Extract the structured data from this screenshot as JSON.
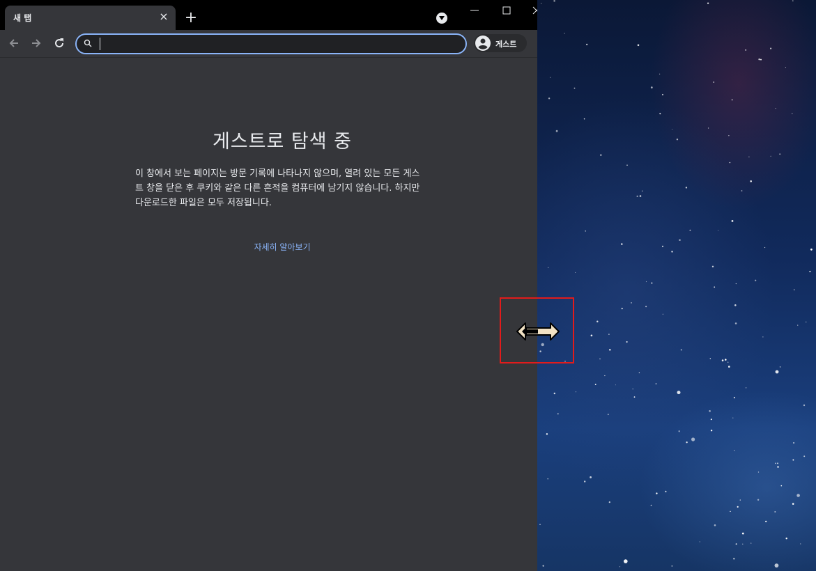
{
  "tabs": [
    {
      "title": "새 탭"
    }
  ],
  "tab_close_icon": "×",
  "new_tab_icon": "+",
  "window_controls": [
    "minimize",
    "maximize",
    "close"
  ],
  "toolbar": {
    "omnibox": {
      "value": "",
      "placeholder": ""
    },
    "profile": {
      "label": "게스트"
    }
  },
  "page": {
    "heading": "게스트로 탐색 중",
    "description": "이 창에서 보는 페이지는 방문 기록에 나타나지 않으며, 열려 있는 모든 게스트 창을 닫은 후 쿠키와 같은 다른 흔적을 컴퓨터에 남기지 않습니다. 하지만 다운로드한 파일은 모두 저장됩니다.",
    "learn_more": "자세히 알아보기"
  },
  "colors": {
    "page_bg": "#35363a",
    "tabstrip_bg": "#000000",
    "accent": "#8ab4f8",
    "text": "#e8eaed",
    "highlight": "#e21b1b"
  },
  "icons": [
    "back-arrow-icon",
    "forward-arrow-icon",
    "reload-icon",
    "search-icon",
    "tab-search-icon",
    "profile-icon",
    "resize-cursor-icon"
  ]
}
